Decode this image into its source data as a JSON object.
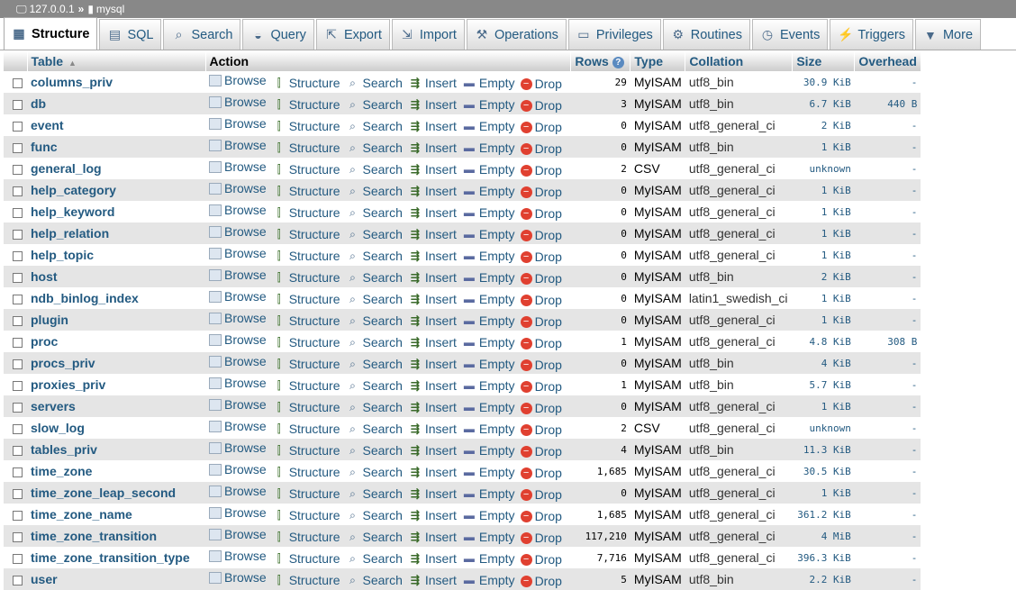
{
  "breadcrumb": {
    "server": "127.0.0.1",
    "separator": "»",
    "database": "mysql"
  },
  "tabs": [
    {
      "label": "Structure",
      "icon": "structure-icon",
      "glyph": "▦",
      "active": true
    },
    {
      "label": "SQL",
      "icon": "sql-icon",
      "glyph": "▤"
    },
    {
      "label": "Search",
      "icon": "search-icon",
      "glyph": "⌕"
    },
    {
      "label": "Query",
      "icon": "query-icon",
      "glyph": "◒"
    },
    {
      "label": "Export",
      "icon": "export-icon",
      "glyph": "⇱"
    },
    {
      "label": "Import",
      "icon": "import-icon",
      "glyph": "⇲"
    },
    {
      "label": "Operations",
      "icon": "wrench-icon",
      "glyph": "⚒"
    },
    {
      "label": "Privileges",
      "icon": "privileges-icon",
      "glyph": "▭"
    },
    {
      "label": "Routines",
      "icon": "routines-icon",
      "glyph": "⚙"
    },
    {
      "label": "Events",
      "icon": "clock-icon",
      "glyph": "◷"
    },
    {
      "label": "Triggers",
      "icon": "triggers-icon",
      "glyph": "⚡"
    },
    {
      "label": "More",
      "icon": "chevron-down-icon",
      "glyph": "▼"
    }
  ],
  "columns": {
    "table": "Table",
    "action": "Action",
    "rows": "Rows",
    "type": "Type",
    "collation": "Collation",
    "size": "Size",
    "overhead": "Overhead"
  },
  "actions": {
    "browse": "Browse",
    "structure": "Structure",
    "search": "Search",
    "insert": "Insert",
    "empty": "Empty",
    "drop": "Drop"
  },
  "tables": [
    {
      "name": "columns_priv",
      "rows": "29",
      "type": "MyISAM",
      "collation": "utf8_bin",
      "size": "30.9 KiB",
      "overhead": "-"
    },
    {
      "name": "db",
      "rows": "3",
      "type": "MyISAM",
      "collation": "utf8_bin",
      "size": "6.7 KiB",
      "overhead": "440 B"
    },
    {
      "name": "event",
      "rows": "0",
      "type": "MyISAM",
      "collation": "utf8_general_ci",
      "size": "2 KiB",
      "overhead": "-"
    },
    {
      "name": "func",
      "rows": "0",
      "type": "MyISAM",
      "collation": "utf8_bin",
      "size": "1 KiB",
      "overhead": "-"
    },
    {
      "name": "general_log",
      "rows": "2",
      "type": "CSV",
      "collation": "utf8_general_ci",
      "size": "unknown",
      "overhead": "-"
    },
    {
      "name": "help_category",
      "rows": "0",
      "type": "MyISAM",
      "collation": "utf8_general_ci",
      "size": "1 KiB",
      "overhead": "-"
    },
    {
      "name": "help_keyword",
      "rows": "0",
      "type": "MyISAM",
      "collation": "utf8_general_ci",
      "size": "1 KiB",
      "overhead": "-"
    },
    {
      "name": "help_relation",
      "rows": "0",
      "type": "MyISAM",
      "collation": "utf8_general_ci",
      "size": "1 KiB",
      "overhead": "-"
    },
    {
      "name": "help_topic",
      "rows": "0",
      "type": "MyISAM",
      "collation": "utf8_general_ci",
      "size": "1 KiB",
      "overhead": "-"
    },
    {
      "name": "host",
      "rows": "0",
      "type": "MyISAM",
      "collation": "utf8_bin",
      "size": "2 KiB",
      "overhead": "-"
    },
    {
      "name": "ndb_binlog_index",
      "rows": "0",
      "type": "MyISAM",
      "collation": "latin1_swedish_ci",
      "size": "1 KiB",
      "overhead": "-"
    },
    {
      "name": "plugin",
      "rows": "0",
      "type": "MyISAM",
      "collation": "utf8_general_ci",
      "size": "1 KiB",
      "overhead": "-"
    },
    {
      "name": "proc",
      "rows": "1",
      "type": "MyISAM",
      "collation": "utf8_general_ci",
      "size": "4.8 KiB",
      "overhead": "308 B"
    },
    {
      "name": "procs_priv",
      "rows": "0",
      "type": "MyISAM",
      "collation": "utf8_bin",
      "size": "4 KiB",
      "overhead": "-"
    },
    {
      "name": "proxies_priv",
      "rows": "1",
      "type": "MyISAM",
      "collation": "utf8_bin",
      "size": "5.7 KiB",
      "overhead": "-"
    },
    {
      "name": "servers",
      "rows": "0",
      "type": "MyISAM",
      "collation": "utf8_general_ci",
      "size": "1 KiB",
      "overhead": "-"
    },
    {
      "name": "slow_log",
      "rows": "2",
      "type": "CSV",
      "collation": "utf8_general_ci",
      "size": "unknown",
      "overhead": "-"
    },
    {
      "name": "tables_priv",
      "rows": "4",
      "type": "MyISAM",
      "collation": "utf8_bin",
      "size": "11.3 KiB",
      "overhead": "-"
    },
    {
      "name": "time_zone",
      "rows": "1,685",
      "type": "MyISAM",
      "collation": "utf8_general_ci",
      "size": "30.5 KiB",
      "overhead": "-"
    },
    {
      "name": "time_zone_leap_second",
      "rows": "0",
      "type": "MyISAM",
      "collation": "utf8_general_ci",
      "size": "1 KiB",
      "overhead": "-"
    },
    {
      "name": "time_zone_name",
      "rows": "1,685",
      "type": "MyISAM",
      "collation": "utf8_general_ci",
      "size": "361.2 KiB",
      "overhead": "-"
    },
    {
      "name": "time_zone_transition",
      "rows": "117,210",
      "type": "MyISAM",
      "collation": "utf8_general_ci",
      "size": "4 MiB",
      "overhead": "-"
    },
    {
      "name": "time_zone_transition_type",
      "rows": "7,716",
      "type": "MyISAM",
      "collation": "utf8_general_ci",
      "size": "396.3 KiB",
      "overhead": "-"
    },
    {
      "name": "user",
      "rows": "5",
      "type": "MyISAM",
      "collation": "utf8_bin",
      "size": "2.2 KiB",
      "overhead": "-"
    }
  ]
}
